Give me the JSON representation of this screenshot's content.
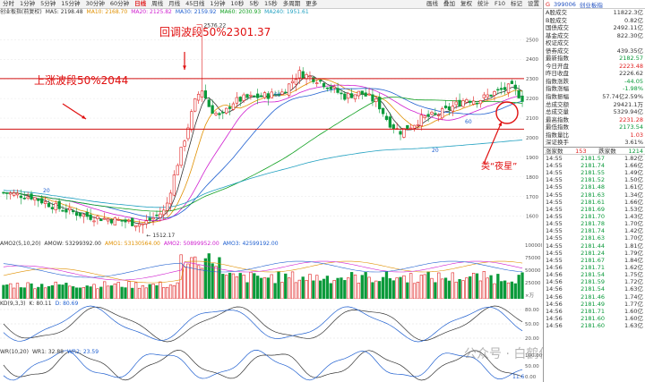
{
  "toolbar": {
    "periods": [
      "分时",
      "1分钟",
      "5分钟",
      "15分钟",
      "30分钟",
      "60分钟",
      "日线",
      "周线",
      "月线",
      "45日线",
      "1分钟",
      "10秒",
      "5秒",
      "15秒",
      "多周期",
      "更多"
    ],
    "active_period": "日线",
    "tools": [
      "画线",
      "叠加",
      "复权",
      "统计",
      "F10",
      "标记",
      "设置"
    ]
  },
  "legend": {
    "index_name": "创业板指(前复权)",
    "ma_items": [
      {
        "label": "MA5: 2198.48",
        "color": "#333333"
      },
      {
        "label": "MA10: 2168.70",
        "color": "#e09000"
      },
      {
        "label": "MA20: 2125.82",
        "color": "#d020d0"
      },
      {
        "label": "MA30: 2159.92",
        "color": "#2060d0"
      },
      {
        "label": "MA60: 2030.93",
        "color": "#10a020"
      },
      {
        "label": "MA240: 1951.61",
        "color": "#20a0c0"
      }
    ]
  },
  "annotations": {
    "retrace": "回调波段50%2301.37",
    "rise": "上涨波段50%2044",
    "evening_star": "类“夜星”",
    "high_label": "2576.22",
    "low_label": "1512.17",
    "tag_20a": "20",
    "tag_60": "60",
    "tag_20b": "20",
    "tag_60b": "60"
  },
  "price_axis": [
    "2500",
    "2400",
    "2300",
    "2200",
    "2100",
    "2000",
    "1900",
    "1800",
    "1700",
    "1600"
  ],
  "sub_charts": {
    "vol": {
      "items": [
        "AMO2(5,10,20)",
        "AMOW: 53299392.00",
        "AMO1: 53130564.00",
        "AMO2: 50899952.00",
        "AMO3: 42599192.00"
      ],
      "axis": [
        "100000",
        "75000",
        "50000",
        "25000",
        "×万"
      ]
    },
    "kd": {
      "items": [
        "KD(9,3,3)",
        "K: 80.11",
        "D: 80.69"
      ],
      "axis": [
        "80.00",
        "50.00",
        "20.00"
      ]
    },
    "wr": {
      "items": [
        "WR(10,20)",
        "WR1: 32.88",
        "WR2: 23.59"
      ],
      "axis": [
        "100.00",
        "50.00",
        "0.00"
      ],
      "last": "11.6"
    }
  },
  "watermark": "公众号 · 白鹤伴0",
  "right_panel": {
    "code": "399006",
    "name": "创业板指",
    "stats": [
      {
        "k": "A股成交",
        "v": "11822.3亿",
        "cls": ""
      },
      {
        "k": "B股成交",
        "v": "0.82亿",
        "cls": ""
      },
      {
        "k": "国债成交",
        "v": "2492.11亿",
        "cls": ""
      },
      {
        "k": "基金成交",
        "v": "822.30亿",
        "cls": ""
      },
      {
        "k": "权证成交",
        "v": "",
        "cls": ""
      },
      {
        "k": "债券成交",
        "v": "439.35亿",
        "cls": ""
      },
      {
        "k": "最新指数",
        "v": "2182.57",
        "cls": "green"
      },
      {
        "k": "今日开盘",
        "v": "2223.48",
        "cls": "red"
      },
      {
        "k": "昨日收盘",
        "v": "2226.62",
        "cls": ""
      },
      {
        "k": "指数涨跌",
        "v": "-44.05",
        "cls": "green"
      },
      {
        "k": "指数涨幅",
        "v": "-1.98%",
        "cls": "green"
      },
      {
        "k": "指数振幅",
        "v": "57.74亿2.59%",
        "cls": ""
      },
      {
        "k": "总成交额",
        "v": "29421.1万",
        "cls": ""
      },
      {
        "k": "总成交量",
        "v": "5329.94亿",
        "cls": ""
      },
      {
        "k": "最高指数",
        "v": "2231.28",
        "cls": "red"
      },
      {
        "k": "最低指数",
        "v": "2173.54",
        "cls": "green"
      },
      {
        "k": "指数量比",
        "v": "1.03",
        "cls": "red"
      },
      {
        "k": "深证换手",
        "v": "3.61%",
        "cls": ""
      }
    ],
    "ticks_header": {
      "left": "涨家数",
      "mid": "153",
      "mid_label": "跌家数",
      "right": "1214"
    },
    "ticks": [
      [
        "14:55",
        "2181.57",
        "1.82亿"
      ],
      [
        "14:55",
        "2181.74",
        "1.66亿"
      ],
      [
        "14:55",
        "2181.55",
        "1.49亿"
      ],
      [
        "14:55",
        "2181.52",
        "1.50亿"
      ],
      [
        "14:55",
        "2181.48",
        "1.61亿"
      ],
      [
        "14:55",
        "2181.63",
        "1.34亿"
      ],
      [
        "14:55",
        "2181.61",
        "1.66亿"
      ],
      [
        "14:55",
        "2181.69",
        "1.53亿"
      ],
      [
        "14:55",
        "2181.70",
        "1.43亿"
      ],
      [
        "14:55",
        "2181.78",
        "1.70亿"
      ],
      [
        "14:55",
        "2181.74",
        "1.42亿"
      ],
      [
        "14:55",
        "2181.63",
        "1.70亿"
      ],
      [
        "14:55",
        "2181.44",
        "1.81亿"
      ],
      [
        "14:55",
        "2181.24",
        "1.79亿"
      ],
      [
        "14:55",
        "2181.67",
        "1.84亿"
      ],
      [
        "14:56",
        "2181.71",
        "1.62亿"
      ],
      [
        "14:56",
        "2181.54",
        "1.75亿"
      ],
      [
        "14:56",
        "2181.59",
        "1.72亿"
      ],
      [
        "14:56",
        "2181.54",
        "1.63亿"
      ],
      [
        "14:56",
        "2181.46",
        "1.74亿"
      ],
      [
        "14:56",
        "2181.49",
        "1.77亿"
      ],
      [
        "14:56",
        "2181.71",
        "1.60亿"
      ],
      [
        "14:56",
        "2181.60",
        "1.60亿"
      ],
      [
        "14:56",
        "2181.60",
        "1.63亿"
      ]
    ]
  },
  "chart_data": {
    "type": "candlestick",
    "ylim": [
      1480,
      2620
    ],
    "hlines": [
      2301.37,
      2044
    ],
    "candles_count": 150
  }
}
